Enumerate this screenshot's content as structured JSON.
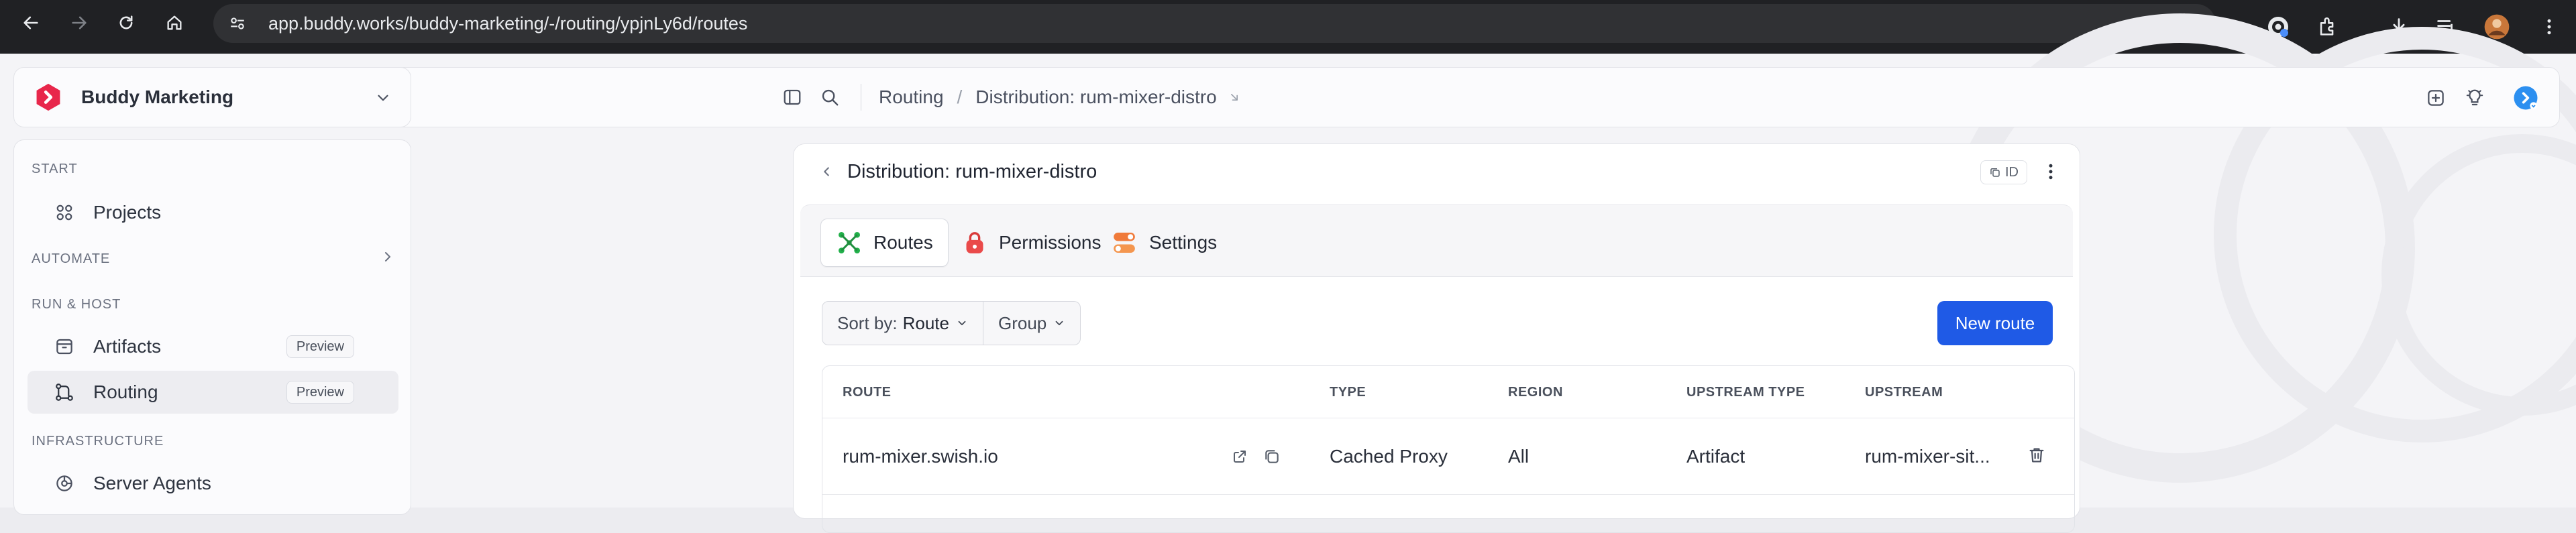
{
  "browser": {
    "url": "app.buddy.works/buddy-marketing/-/routing/ypjnLy6d/routes"
  },
  "org": {
    "name": "Buddy Marketing",
    "logo_color": "#e8274b"
  },
  "sidebar": {
    "sections": {
      "start": "START",
      "automate": "AUTOMATE",
      "run_host": "RUN & HOST",
      "infrastructure": "INFRASTRUCTURE"
    },
    "items": {
      "projects": "Projects",
      "artifacts": "Artifacts",
      "artifacts_badge": "Preview",
      "routing": "Routing",
      "routing_badge": "Preview",
      "server_agents": "Server Agents"
    }
  },
  "breadcrumb": {
    "items": [
      "Routing",
      "Distribution: rum-mixer-distro"
    ],
    "separator": "/"
  },
  "panel": {
    "title": "Distribution: rum-mixer-distro",
    "id_label": "ID",
    "tabs": [
      {
        "label": "Routes",
        "icon": "routes-icon",
        "active": true
      },
      {
        "label": "Permissions",
        "icon": "lock-icon",
        "active": false
      },
      {
        "label": "Settings",
        "icon": "toggles-icon",
        "active": false
      }
    ],
    "sort_prefix": "Sort by:",
    "sort_value": "Route",
    "group_label": "Group",
    "new_route_label": "New route",
    "accent_color": "#1f5ae6"
  },
  "table": {
    "columns": [
      "ROUTE",
      "TYPE",
      "REGION",
      "UPSTREAM TYPE",
      "UPSTREAM"
    ],
    "rows": [
      {
        "route": "rum-mixer.swish.io",
        "type": "Cached Proxy",
        "region": "All",
        "upstream_type": "Artifact",
        "upstream": "rum-mixer-sit..."
      }
    ]
  }
}
